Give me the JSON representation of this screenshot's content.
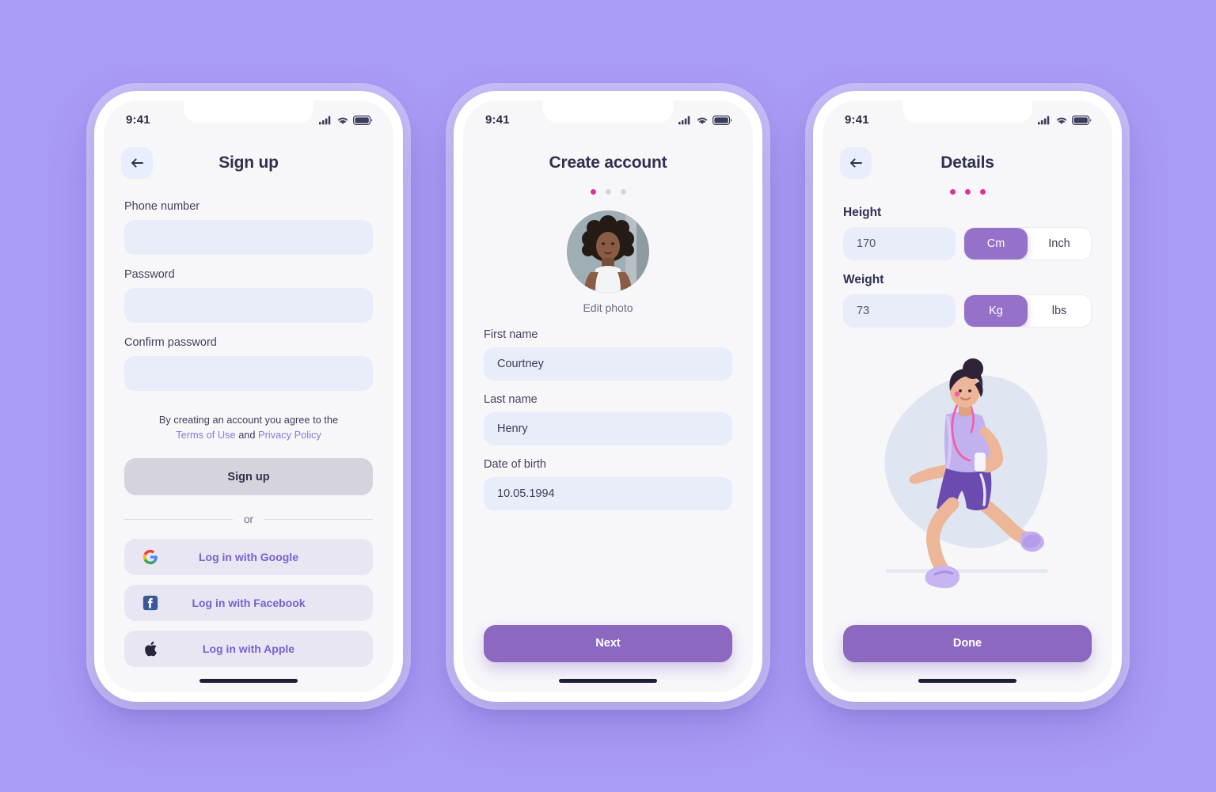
{
  "background_color": "#a99cf5",
  "accent_purple": "#8d68c0",
  "accent_pink": "#e0329c",
  "link_color": "#8b76dd",
  "screens": [
    {
      "id": "sign-up",
      "status": {
        "time": "9:41",
        "icons": [
          "cellular-icon",
          "wifi-icon",
          "battery-icon"
        ]
      },
      "nav": {
        "back": "back-arrow-icon",
        "title": "Sign up"
      },
      "fields": [
        {
          "label": "Phone number",
          "value": ""
        },
        {
          "label": "Password",
          "value": ""
        },
        {
          "label": "Confirm password",
          "value": ""
        }
      ],
      "legal": {
        "prefix": "By creating an account you agree to the",
        "terms": "Terms of Use",
        "and": "and",
        "privacy": "Privacy Policy"
      },
      "submit_label": "Sign up",
      "divider_label": "or",
      "social": [
        {
          "icon": "google-icon",
          "label": "Log in with Google"
        },
        {
          "icon": "facebook-icon",
          "label": "Log in with Facebook"
        },
        {
          "icon": "apple-icon",
          "label": "Log in with Apple"
        }
      ]
    },
    {
      "id": "create-account",
      "status": {
        "time": "9:41"
      },
      "nav": {
        "title": "Create account"
      },
      "dots": {
        "count": 3,
        "active_index": 0
      },
      "avatar": {
        "alt": "profile-photo",
        "edit_label": "Edit photo"
      },
      "fields": [
        {
          "label": "First name",
          "value": "Courtney"
        },
        {
          "label": "Last name",
          "value": "Henry"
        },
        {
          "label": "Date of birth",
          "value": "10.05.1994"
        }
      ],
      "submit_label": "Next"
    },
    {
      "id": "details",
      "status": {
        "time": "9:41"
      },
      "nav": {
        "back": "back-arrow-icon",
        "title": "Details"
      },
      "dots": {
        "count": 3,
        "active_index": -1
      },
      "measures": [
        {
          "label": "Height",
          "value": "170",
          "units": [
            {
              "label": "Cm",
              "selected": true
            },
            {
              "label": "Inch",
              "selected": false
            }
          ]
        },
        {
          "label": "Weight",
          "value": "73",
          "units": [
            {
              "label": "Kg",
              "selected": true
            },
            {
              "label": "lbs",
              "selected": false
            }
          ]
        }
      ],
      "illustration": "running-woman-illustration",
      "submit_label": "Done"
    }
  ]
}
